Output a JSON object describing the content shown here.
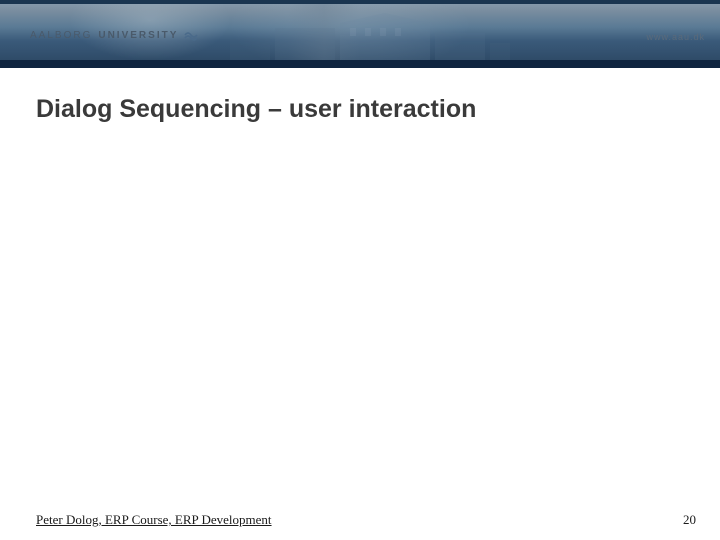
{
  "header": {
    "university_name_part1": "AALBORG",
    "university_name_part2": "UNIVERSITY",
    "website": "www.aau.dk",
    "logo_icon": "aau-wave-logo"
  },
  "slide": {
    "title": "Dialog Sequencing – user interaction"
  },
  "footer": {
    "author_line": "Peter Dolog, ERP Course, ERP Development",
    "page_number": "20"
  }
}
